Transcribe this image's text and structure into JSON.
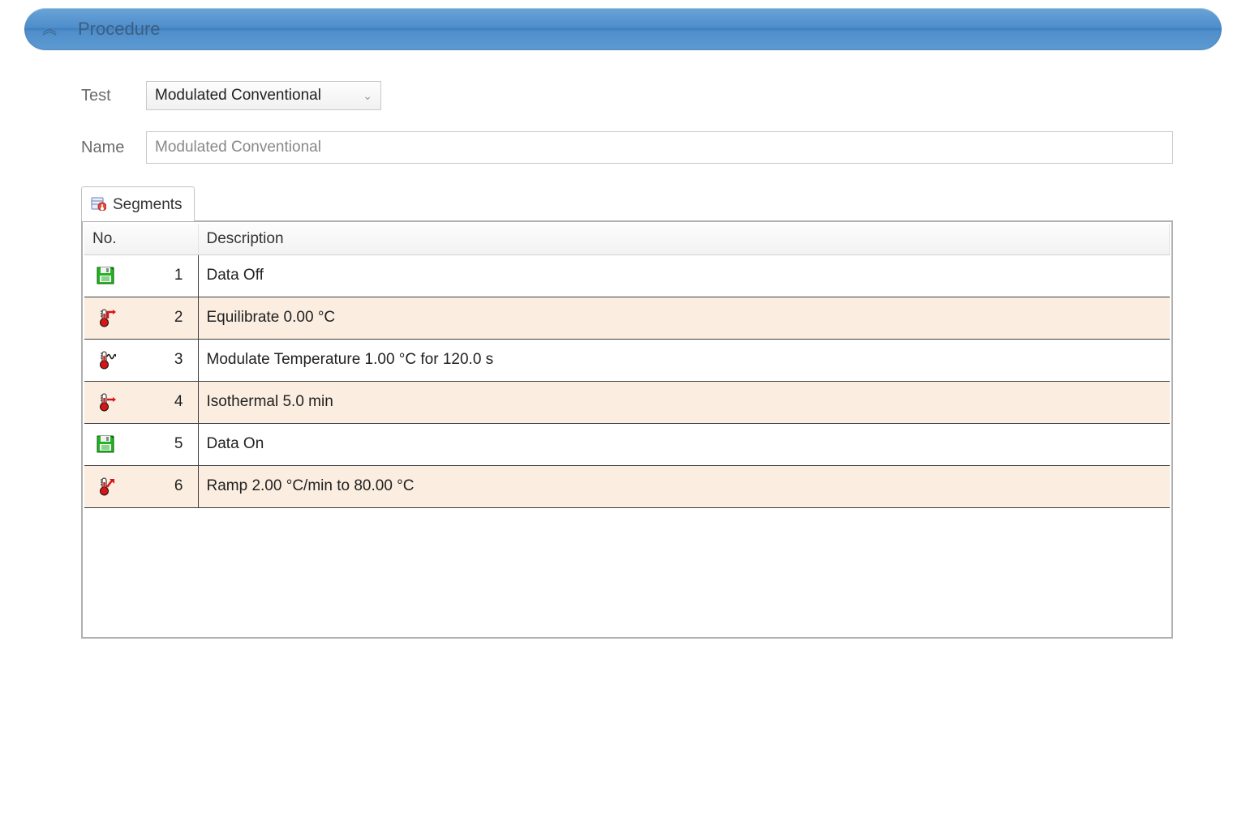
{
  "panel": {
    "title": "Procedure"
  },
  "form": {
    "test_label": "Test",
    "test_value": "Modulated Conventional",
    "name_label": "Name",
    "name_value": "Modulated Conventional"
  },
  "tabs": {
    "segments_label": "Segments"
  },
  "table": {
    "col_no": "No.",
    "col_desc": "Description",
    "rows": [
      {
        "no": "1",
        "icon": "disk-green",
        "desc": "Data Off"
      },
      {
        "no": "2",
        "icon": "thermo-equil",
        "desc": "Equilibrate 0.00 °C"
      },
      {
        "no": "3",
        "icon": "thermo-mod",
        "desc": "Modulate Temperature 1.00 °C for 120.0 s"
      },
      {
        "no": "4",
        "icon": "thermo-iso",
        "desc": "Isothermal 5.0 min"
      },
      {
        "no": "5",
        "icon": "disk-green",
        "desc": "Data On"
      },
      {
        "no": "6",
        "icon": "thermo-ramp",
        "desc": "Ramp 2.00 °C/min to 80.00 °C"
      }
    ]
  }
}
